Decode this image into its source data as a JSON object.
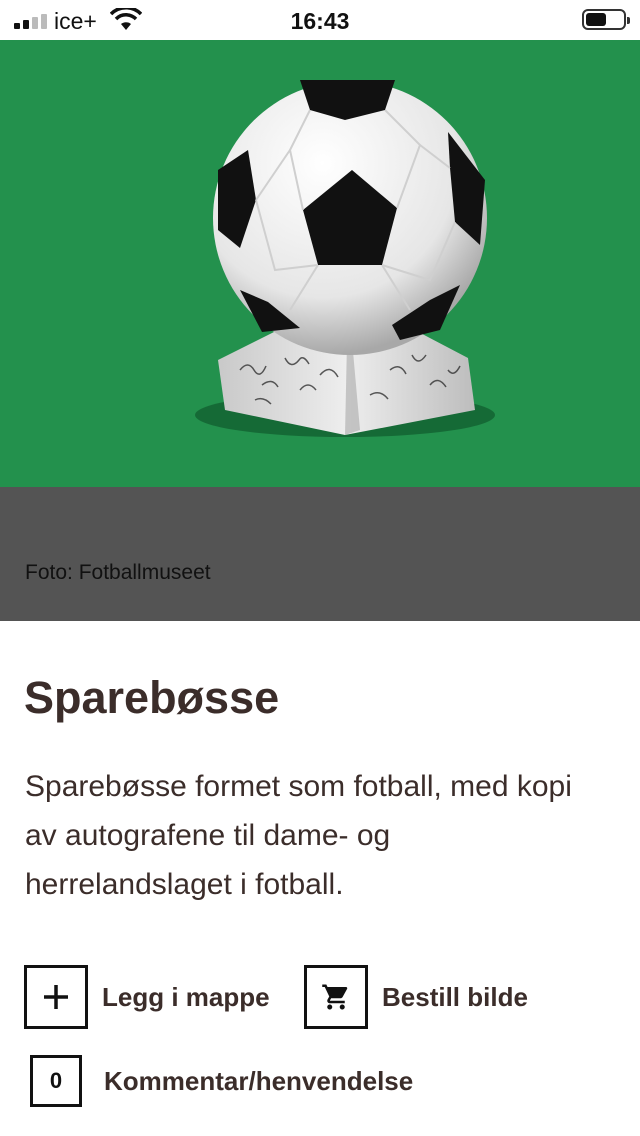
{
  "status_bar": {
    "carrier": "ice+",
    "time": "16:43",
    "signal_bars_active": 2,
    "signal_bars_total": 4,
    "battery_level": 0.55
  },
  "photo": {
    "caption": "Foto: Fotballmuseet",
    "background_color": "#23914d"
  },
  "item": {
    "title": "Sparebøsse",
    "description": "Sparebøsse formet som fotball, med kopi av autografene til dame- og herrelandslaget i fotball."
  },
  "actions": {
    "add_to_folder": {
      "icon": "plus-icon",
      "label": "Legg i mappe"
    },
    "order_image": {
      "icon": "cart-icon",
      "label": "Bestill bilde"
    },
    "comment": {
      "icon": "speech-bubble-icon",
      "count": "0",
      "label": "Kommentar/henvendelse"
    }
  }
}
